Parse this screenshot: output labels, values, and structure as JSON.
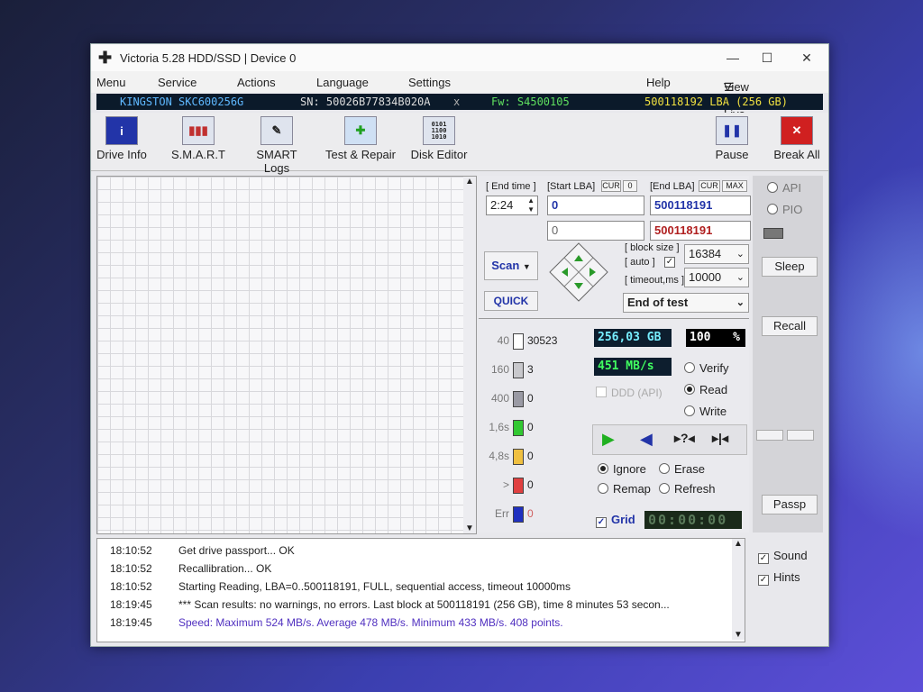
{
  "window": {
    "title": "Victoria 5.28 HDD/SSD | Device 0"
  },
  "menu": [
    "Menu",
    "Service",
    "Actions",
    "Language",
    "Settings",
    "Help"
  ],
  "view_buffer_label": "View Buffer Live",
  "drive": {
    "model": "KINGSTON SKC600256G",
    "serial": "SN: 50026B77834B020A",
    "x": "x",
    "firmware": "Fw: S4500105",
    "capacity": "500118192 LBA (256 GB)"
  },
  "toolbar": {
    "drive_info": "Drive Info",
    "smart": "S.M.A.R.T",
    "smart_logs": "SMART Logs",
    "test_repair": "Test & Repair",
    "disk_editor": "Disk Editor",
    "pause": "Pause",
    "break_all": "Break All"
  },
  "test": {
    "end_time_label": "[ End time ]",
    "end_time": "2:24",
    "start_lba_label": "[Start LBA]",
    "cur_label": "CUR",
    "start_cur": "0",
    "start_lba": "0",
    "start_lba2": "0",
    "end_lba_label": "[End LBA]",
    "end_cur": "CUR",
    "max_label": "MAX",
    "end_lba": "500118191",
    "end_lba2": "500118191",
    "scan_label": "Scan",
    "quick_label": "QUICK",
    "block_size_label": "[ block size ]",
    "auto_label": "[ auto ]",
    "block_size": "16384",
    "timeout_label": "[ timeout,ms ]",
    "timeout": "10000",
    "end_action": "End of test"
  },
  "blocks": [
    {
      "label": "40",
      "count": "30523",
      "color": "#ffffff"
    },
    {
      "label": "160",
      "count": "3",
      "color": "#c8c8cc"
    },
    {
      "label": "400",
      "count": "0",
      "color": "#9a9aa4"
    },
    {
      "label": "1,6s",
      "count": "0",
      "color": "#32c832"
    },
    {
      "label": "4,8s",
      "count": "0",
      "color": "#f0c040"
    },
    {
      "label": ">",
      "count": "0",
      "color": "#e04040"
    },
    {
      "label": "Err",
      "count": "0",
      "color": "#2030c0"
    }
  ],
  "stats": {
    "size": "256,03 GB",
    "percent": "100",
    "percent_sign": "%",
    "speed": "451 MB/s"
  },
  "modes": {
    "verify": "Verify",
    "read": "Read",
    "write": "Write",
    "ddd": "DDD (API)"
  },
  "actions": {
    "ignore": "Ignore",
    "erase": "Erase",
    "remap": "Remap",
    "refresh": "Refresh",
    "grid": "Grid",
    "timer": "00:00:00"
  },
  "side": {
    "api": "API",
    "pio": "PIO",
    "sleep": "Sleep",
    "recall": "Recall",
    "passp": "Passp"
  },
  "log": [
    {
      "time": "18:10:52",
      "msg": "Get drive passport... OK",
      "color": "#222222"
    },
    {
      "time": "18:10:52",
      "msg": "Recallibration... OK",
      "color": "#222222"
    },
    {
      "time": "18:10:52",
      "msg": "Starting Reading, LBA=0..500118191, FULL, sequential access, timeout 10000ms",
      "color": "#222222"
    },
    {
      "time": "18:19:45",
      "msg": "*** Scan results: no warnings, no errors. Last block at 500118191 (256 GB), time 8 minutes 53 secon...",
      "color": "#222222"
    },
    {
      "time": "18:19:45",
      "msg": "Speed: Maximum 524 MB/s. Average 478 MB/s. Minimum 433 MB/s. 408 points.",
      "color": "#5030c0"
    }
  ],
  "options": {
    "sound": "Sound",
    "hints": "Hints"
  }
}
